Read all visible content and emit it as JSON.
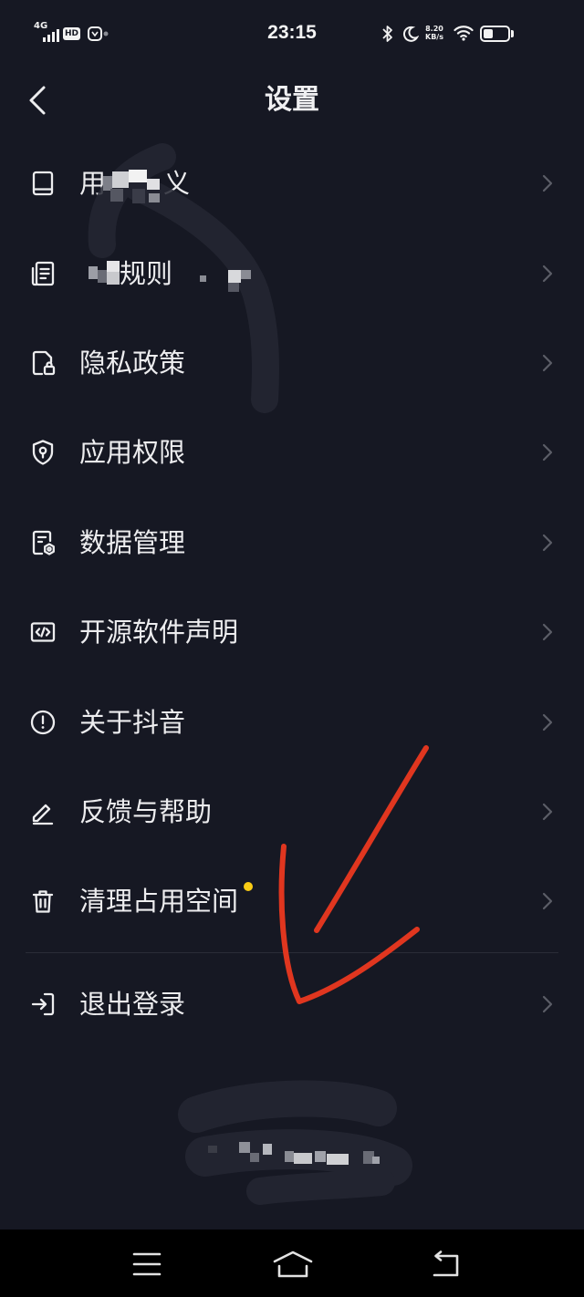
{
  "status_bar": {
    "network_type": "4G",
    "hd_label": "HD",
    "time": "23:15",
    "net_speed_value": "8.20",
    "net_speed_unit": "KB/s",
    "battery_level": 0.4,
    "icons": [
      "signal-icon",
      "app-notification-icon",
      "bluetooth-icon",
      "moon-icon",
      "wifi-icon",
      "battery-icon"
    ]
  },
  "header": {
    "title": "设置",
    "back_icon": "chevron-left-icon"
  },
  "items": [
    {
      "icon": "book-icon",
      "label": "用",
      "label_after": "义"
    },
    {
      "icon": "document-list-icon",
      "label": "规则"
    },
    {
      "icon": "privacy-lock-icon",
      "label": "隐私政策"
    },
    {
      "icon": "shield-icon",
      "label": "应用权限"
    },
    {
      "icon": "data-settings-icon",
      "label": "数据管理"
    },
    {
      "icon": "code-icon",
      "label": "开源软件声明"
    },
    {
      "icon": "info-icon",
      "label": "关于抖音"
    },
    {
      "icon": "pencil-icon",
      "label": "反馈与帮助"
    },
    {
      "icon": "trash-icon",
      "label": "清理占用空间",
      "badge_dot": true
    }
  ],
  "logout": {
    "icon": "logout-icon",
    "label": "退出登录"
  },
  "nav_bar": {
    "icons": [
      "menu-icon",
      "home-icon",
      "back-icon"
    ]
  },
  "colors": {
    "background": "#161823",
    "text": "#ededef",
    "chevron": "#5b5d67",
    "badge_dot": "#facc15",
    "annotation": "#e0361f",
    "nav_bar": "#000000"
  }
}
